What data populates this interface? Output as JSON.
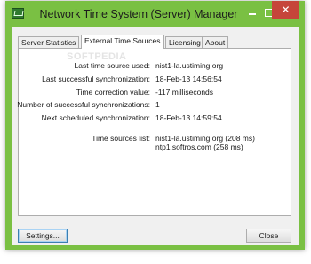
{
  "window": {
    "title": "Network Time System (Server) Manager",
    "accent_color": "#7ac043",
    "controls": {
      "minimize": "–",
      "maximize": "□",
      "close": "✕"
    },
    "icon": "network-time-app-icon"
  },
  "tabs": [
    {
      "label": "Server Statistics",
      "active": false
    },
    {
      "label": "External Time Sources",
      "active": true
    },
    {
      "label": "Licensing",
      "active": false
    },
    {
      "label": "About",
      "active": false
    }
  ],
  "watermark": "SOFTPEDIA",
  "details": [
    {
      "label": "Last time source used:",
      "value": "nist1-la.ustiming.org"
    },
    {
      "label": "Last successful synchronization:",
      "value": "18-Feb-13 14:56:54"
    },
    {
      "label": "Time correction value:",
      "value": "-117 milliseconds"
    },
    {
      "label": "Number of successful synchronizations:",
      "value": "1"
    },
    {
      "label": "Next scheduled synchronization:",
      "value": "18-Feb-13 14:59:54"
    }
  ],
  "time_sources": {
    "label": "Time sources list:",
    "items": [
      "nist1-la.ustiming.org (208 ms)",
      "ntp1.softros.com (258 ms)"
    ]
  },
  "buttons": {
    "settings": "Settings...",
    "close": "Close"
  }
}
